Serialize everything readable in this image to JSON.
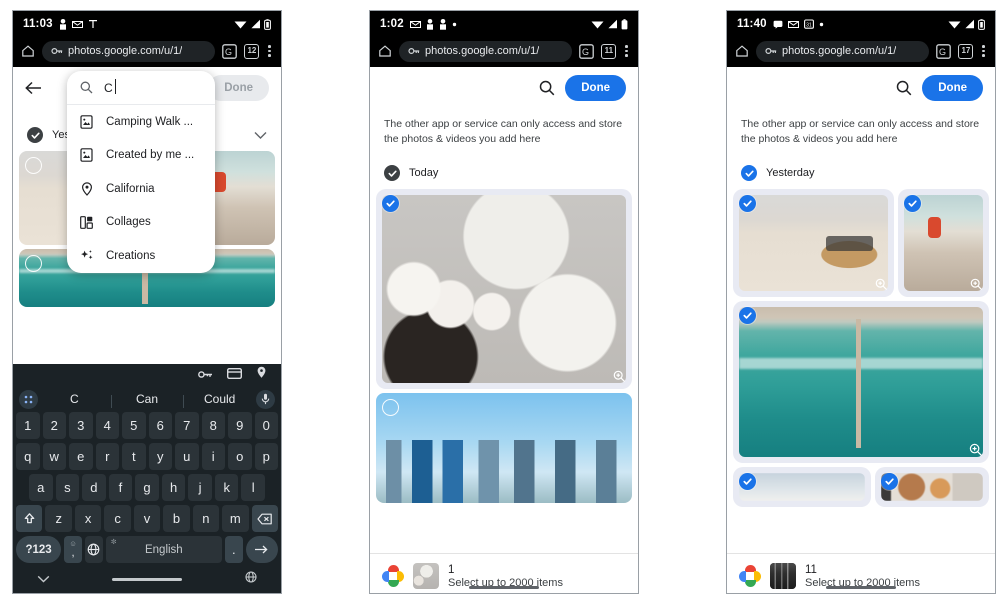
{
  "panels": [
    {
      "id": "panel-search",
      "status_bar": {
        "time": "11:03",
        "left_icons": [
          "person-icon",
          "gmail-icon",
          "antenna-icon"
        ],
        "right_icons": [
          "wifi-icon",
          "signal-icon",
          "battery-icon"
        ]
      },
      "browser": {
        "home_icon": "home-icon",
        "lock_icon": "permissions-icon",
        "url": "photos.google.com/u/1/",
        "translate_icon": "google-translate-icon",
        "tab_count": "12",
        "menu_icon": "kebab-menu-icon"
      },
      "app_bar": {
        "back_icon": "back-arrow-icon",
        "done_label": "Done",
        "done_state": "disabled"
      },
      "section": {
        "label": "Yesterday",
        "checked": true,
        "chevron": "chevron-down-icon"
      },
      "search_dropdown": {
        "query": "C",
        "search_icon": "search-icon",
        "suggestions": [
          {
            "label": "Camping Walk ...",
            "icon": "photo-album-icon"
          },
          {
            "label": "Created by me ...",
            "icon": "photo-album-icon"
          },
          {
            "label": "California",
            "icon": "location-pin-icon"
          },
          {
            "label": "Collages",
            "icon": "collage-icon"
          },
          {
            "label": "Creations",
            "icon": "sparkle-icon"
          }
        ]
      },
      "keyboard": {
        "toolbar_icons": [
          "password-key-icon",
          "card-icon",
          "location-pin-icon"
        ],
        "apps_icon": "keyboard-apps-icon",
        "mic_icon": "microphone-icon",
        "suggestions": [
          "C",
          "Can",
          "Could"
        ],
        "number_row": [
          "1",
          "2",
          "3",
          "4",
          "5",
          "6",
          "7",
          "8",
          "9",
          "0"
        ],
        "row1": [
          "q",
          "w",
          "e",
          "r",
          "t",
          "y",
          "u",
          "i",
          "o",
          "p"
        ],
        "row2": [
          "a",
          "s",
          "d",
          "f",
          "g",
          "h",
          "j",
          "k",
          "l"
        ],
        "row3": [
          "z",
          "x",
          "c",
          "v",
          "b",
          "n",
          "m"
        ],
        "shift_icon": "shift-icon",
        "backspace_icon": "backspace-icon",
        "symbols_label": "?123",
        "emoji_label": "emoji-comma-key",
        "globe_icon": "language-globe-icon",
        "space_label": "English",
        "period_label": ".",
        "enter_icon": "enter-arrow-icon",
        "nav_down_icon": "chevron-down-icon",
        "nav_globe_icon": "globe-icon"
      }
    },
    {
      "id": "panel-today",
      "status_bar": {
        "time": "1:02",
        "left_icons": [
          "gmail-icon",
          "person-icon",
          "person-icon",
          "dot-icon"
        ],
        "right_icons": [
          "wifi-icon",
          "signal-icon",
          "battery-icon"
        ]
      },
      "browser": {
        "home_icon": "home-icon",
        "lock_icon": "permissions-icon",
        "url": "photos.google.com/u/1/",
        "translate_icon": "google-translate-icon",
        "tab_count": "11",
        "menu_icon": "kebab-menu-icon"
      },
      "app_bar": {
        "search_icon": "search-icon",
        "done_label": "Done",
        "done_state": "active"
      },
      "notice": "The other app or service can only access and store the photos & videos you add here",
      "section": {
        "label": "Today",
        "checked": true,
        "check_color": "#3c4043"
      },
      "photos": [
        {
          "name": "korean-food-platter",
          "selected": true,
          "art": "art-food",
          "zoom_icon": "zoom-in-icon"
        },
        {
          "name": "city-skyline",
          "selected": false,
          "art": "art-city",
          "zoom_icon": ""
        }
      ],
      "bottom_bar": {
        "logo": "google-photos-logo",
        "thumb": "selected-photo-thumbnail",
        "count": "1",
        "hint": "Select up to 2000 items"
      }
    },
    {
      "id": "panel-yesterday",
      "status_bar": {
        "time": "11:40",
        "left_icons": [
          "chat-icon",
          "gmail-icon",
          "calendar-icon",
          "dot-icon"
        ],
        "right_icons": [
          "wifi-icon",
          "signal-icon",
          "battery-icon"
        ]
      },
      "browser": {
        "home_icon": "home-icon",
        "lock_icon": "permissions-icon",
        "url": "photos.google.com/u/1/",
        "translate_icon": "google-translate-icon",
        "tab_count": "17",
        "menu_icon": "kebab-menu-icon"
      },
      "app_bar": {
        "search_icon": "search-icon",
        "done_label": "Done",
        "done_state": "active"
      },
      "notice": "The other app or service can only access and store the photos & videos you add here",
      "section": {
        "label": "Yesterday",
        "checked": true,
        "check_color": "#1a73e8"
      },
      "photos": [
        {
          "name": "beach-bag-sandals",
          "selected": true,
          "art": "art-beachbag",
          "zoom_icon": "zoom-in-icon"
        },
        {
          "name": "rocks-towel",
          "selected": true,
          "art": "art-rocks",
          "zoom_icon": "zoom-in-icon"
        },
        {
          "name": "aerial-ocean-pier",
          "selected": true,
          "art": "art-ocean",
          "zoom_icon": "zoom-in-icon"
        },
        {
          "name": "blurred-beach",
          "selected": true,
          "art": "art-blur1",
          "zoom_icon": ""
        },
        {
          "name": "blurred-interior",
          "selected": true,
          "art": "art-blur2",
          "zoom_icon": ""
        }
      ],
      "bottom_bar": {
        "logo": "google-photos-logo",
        "thumb": "selected-photo-thumbnail",
        "count": "11",
        "hint": "Select up to 2000 items"
      }
    }
  ],
  "colors": {
    "accent_blue": "#1a73e8",
    "selection_tint": "#e8eaf3",
    "status_bar_bg": "#000000",
    "keyboard_bg": "#1b2226",
    "key_bg": "#2b3338"
  }
}
